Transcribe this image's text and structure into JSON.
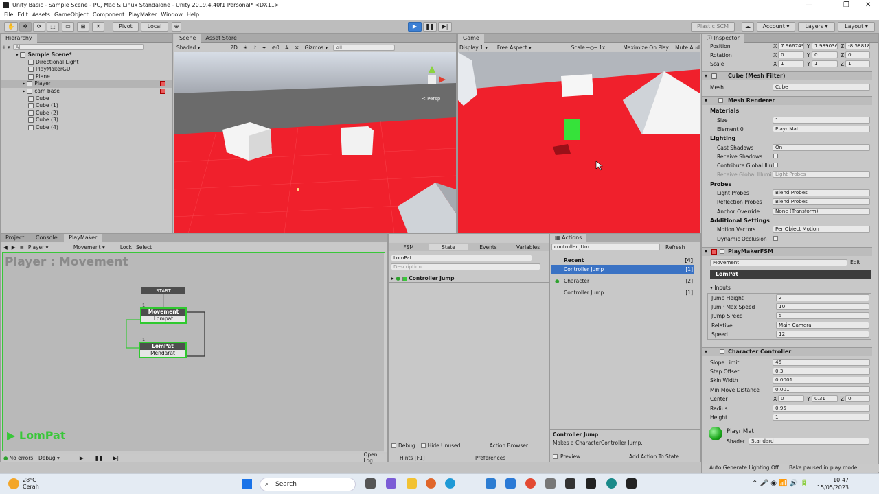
{
  "window": {
    "title": "Unity Basic - Sample Scene - PC, Mac & Linux Standalone - Unity 2019.4.40f1 Personal* <DX11>"
  },
  "menu": [
    "File",
    "Edit",
    "Assets",
    "GameObject",
    "Component",
    "PlayMaker",
    "Window",
    "Help"
  ],
  "toolbar": {
    "pivot": "Pivot",
    "local": "Local",
    "plastic": "Plastic SCM",
    "account": "Account",
    "layers": "Layers",
    "layout": "Layout"
  },
  "hierarchy": {
    "tab": "Hierarchy",
    "search": "All",
    "scene": "Sample Scene*",
    "items": [
      "Directional Light",
      "PlayMakerGUI",
      "Plane",
      "Player",
      "cam base",
      "Cube",
      "Cube (1)",
      "Cube (2)",
      "Cube (3)",
      "Cube (4)"
    ]
  },
  "scene": {
    "tab": "Scene",
    "tab2": "Asset Store",
    "shading": "Shaded",
    "mode2d": "2D",
    "gizmos": "Gizmos",
    "search": "All",
    "persp": "< Persp",
    "hidden_count": "0"
  },
  "game": {
    "tab": "Game",
    "display": "Display 1",
    "aspect": "Free Aspect",
    "scale_label": "Scale",
    "scale_value": "1x",
    "maximize": "Maximize On Play",
    "mute": "Mute Aud"
  },
  "playmaker": {
    "tabs": [
      "Project",
      "Console",
      "PlayMaker"
    ],
    "go": "Player",
    "fsm": "Movement",
    "lock": "Lock",
    "select": "Select",
    "title": "Player : Movement",
    "start": "START",
    "state1_title": "Movement",
    "state1_event": "Lompat",
    "state2_title": "LomPat",
    "state2_event": "Mendarat",
    "state1_num": "1",
    "state2_num": "1",
    "active": "LomPat",
    "errors": "No errors",
    "debug": "Debug",
    "openlog": "Open Log",
    "hints": "Hints [F1]",
    "prefs": "Preferences"
  },
  "fsmpanel": {
    "tabs": [
      "FSM",
      "State",
      "Events",
      "Variables"
    ],
    "state_name": "LomPat",
    "desc_placeholder": "Description...",
    "action": "Controller Jump",
    "debug": "Debug",
    "hide_unused": "Hide Unused",
    "action_browser": "Action Browser"
  },
  "actions": {
    "tab": "Actions",
    "search": "controller jUm",
    "refresh": "Refresh",
    "groups": [
      {
        "name": "Recent",
        "count": "[4]"
      },
      {
        "name": "Controller Jump",
        "count": "[1]",
        "selected": true
      },
      {
        "name": "Character",
        "count": "[2]"
      },
      {
        "name": "Controller Jump",
        "count": "[1]"
      }
    ],
    "desc_title": "Controller Jump",
    "desc": "Makes a CharacterController Jump.",
    "preview": "Preview",
    "add": "Add Action To State"
  },
  "inspector": {
    "tab": "Inspector",
    "transform": {
      "position_label": "Position",
      "rotation_label": "Rotation",
      "scale_label": "Scale",
      "position": [
        "7.966749",
        "1.989036",
        "-8.58818"
      ],
      "rotation": [
        "0",
        "0",
        "0"
      ],
      "scale": [
        "1",
        "1",
        "1"
      ]
    },
    "meshfilter": {
      "title": "Cube (Mesh Filter)",
      "mesh_label": "Mesh",
      "mesh": "Cube"
    },
    "renderer": {
      "title": "Mesh Renderer",
      "materials": "Materials",
      "size_label": "Size",
      "size": "1",
      "element_label": "Element 0",
      "element": "Playr Mat",
      "lighting": "Lighting",
      "cast_label": "Cast Shadows",
      "cast": "On",
      "receive_label": "Receive Shadows",
      "contrib_label": "Contribute Global Illu",
      "recgi_label": "Receive Global Illumi",
      "recgi": "Light Probes",
      "probes": "Probes",
      "lp_label": "Light Probes",
      "lp": "Blend Probes",
      "rp_label": "Reflection Probes",
      "rp": "Blend Probes",
      "anchor_label": "Anchor Override",
      "anchor": "None (Transform)",
      "additional": "Additional Settings",
      "mv_label": "Motion Vectors",
      "mv": "Per Object Motion",
      "dyn_label": "Dynamic Occlusion"
    },
    "fsm": {
      "title": "PlayMakerFSM",
      "name": "Movement",
      "edit": "Edit",
      "state": "LomPat",
      "inputs": "Inputs",
      "rows": [
        [
          "Jump Height",
          "2"
        ],
        [
          "JumP Max Speed",
          "10"
        ],
        [
          "JUmp SPeed",
          "5"
        ],
        [
          "Relative",
          "Main Camera"
        ],
        [
          "Speed",
          "12"
        ]
      ]
    },
    "cc": {
      "title": "Character Controller",
      "rows": [
        [
          "Slope Limit",
          "45"
        ],
        [
          "Step Offset",
          "0.3"
        ],
        [
          "Skin Width",
          "0.0001"
        ],
        [
          "Min Move Distance",
          "0.001"
        ]
      ],
      "center_label": "Center",
      "center": [
        "0",
        "0.31",
        "0"
      ],
      "radius_label": "Radius",
      "radius": "0.95",
      "height_label": "Height",
      "height": "1"
    },
    "material": {
      "name": "Playr Mat",
      "shader_label": "Shader",
      "shader": "Standard"
    },
    "status1": "Auto Generate Lighting Off",
    "status2": "Bake paused in play mode"
  },
  "taskbar": {
    "temp": "28°C",
    "weather": "Cerah",
    "search": "Search",
    "time": "10.47",
    "date": "15/05/2023"
  }
}
